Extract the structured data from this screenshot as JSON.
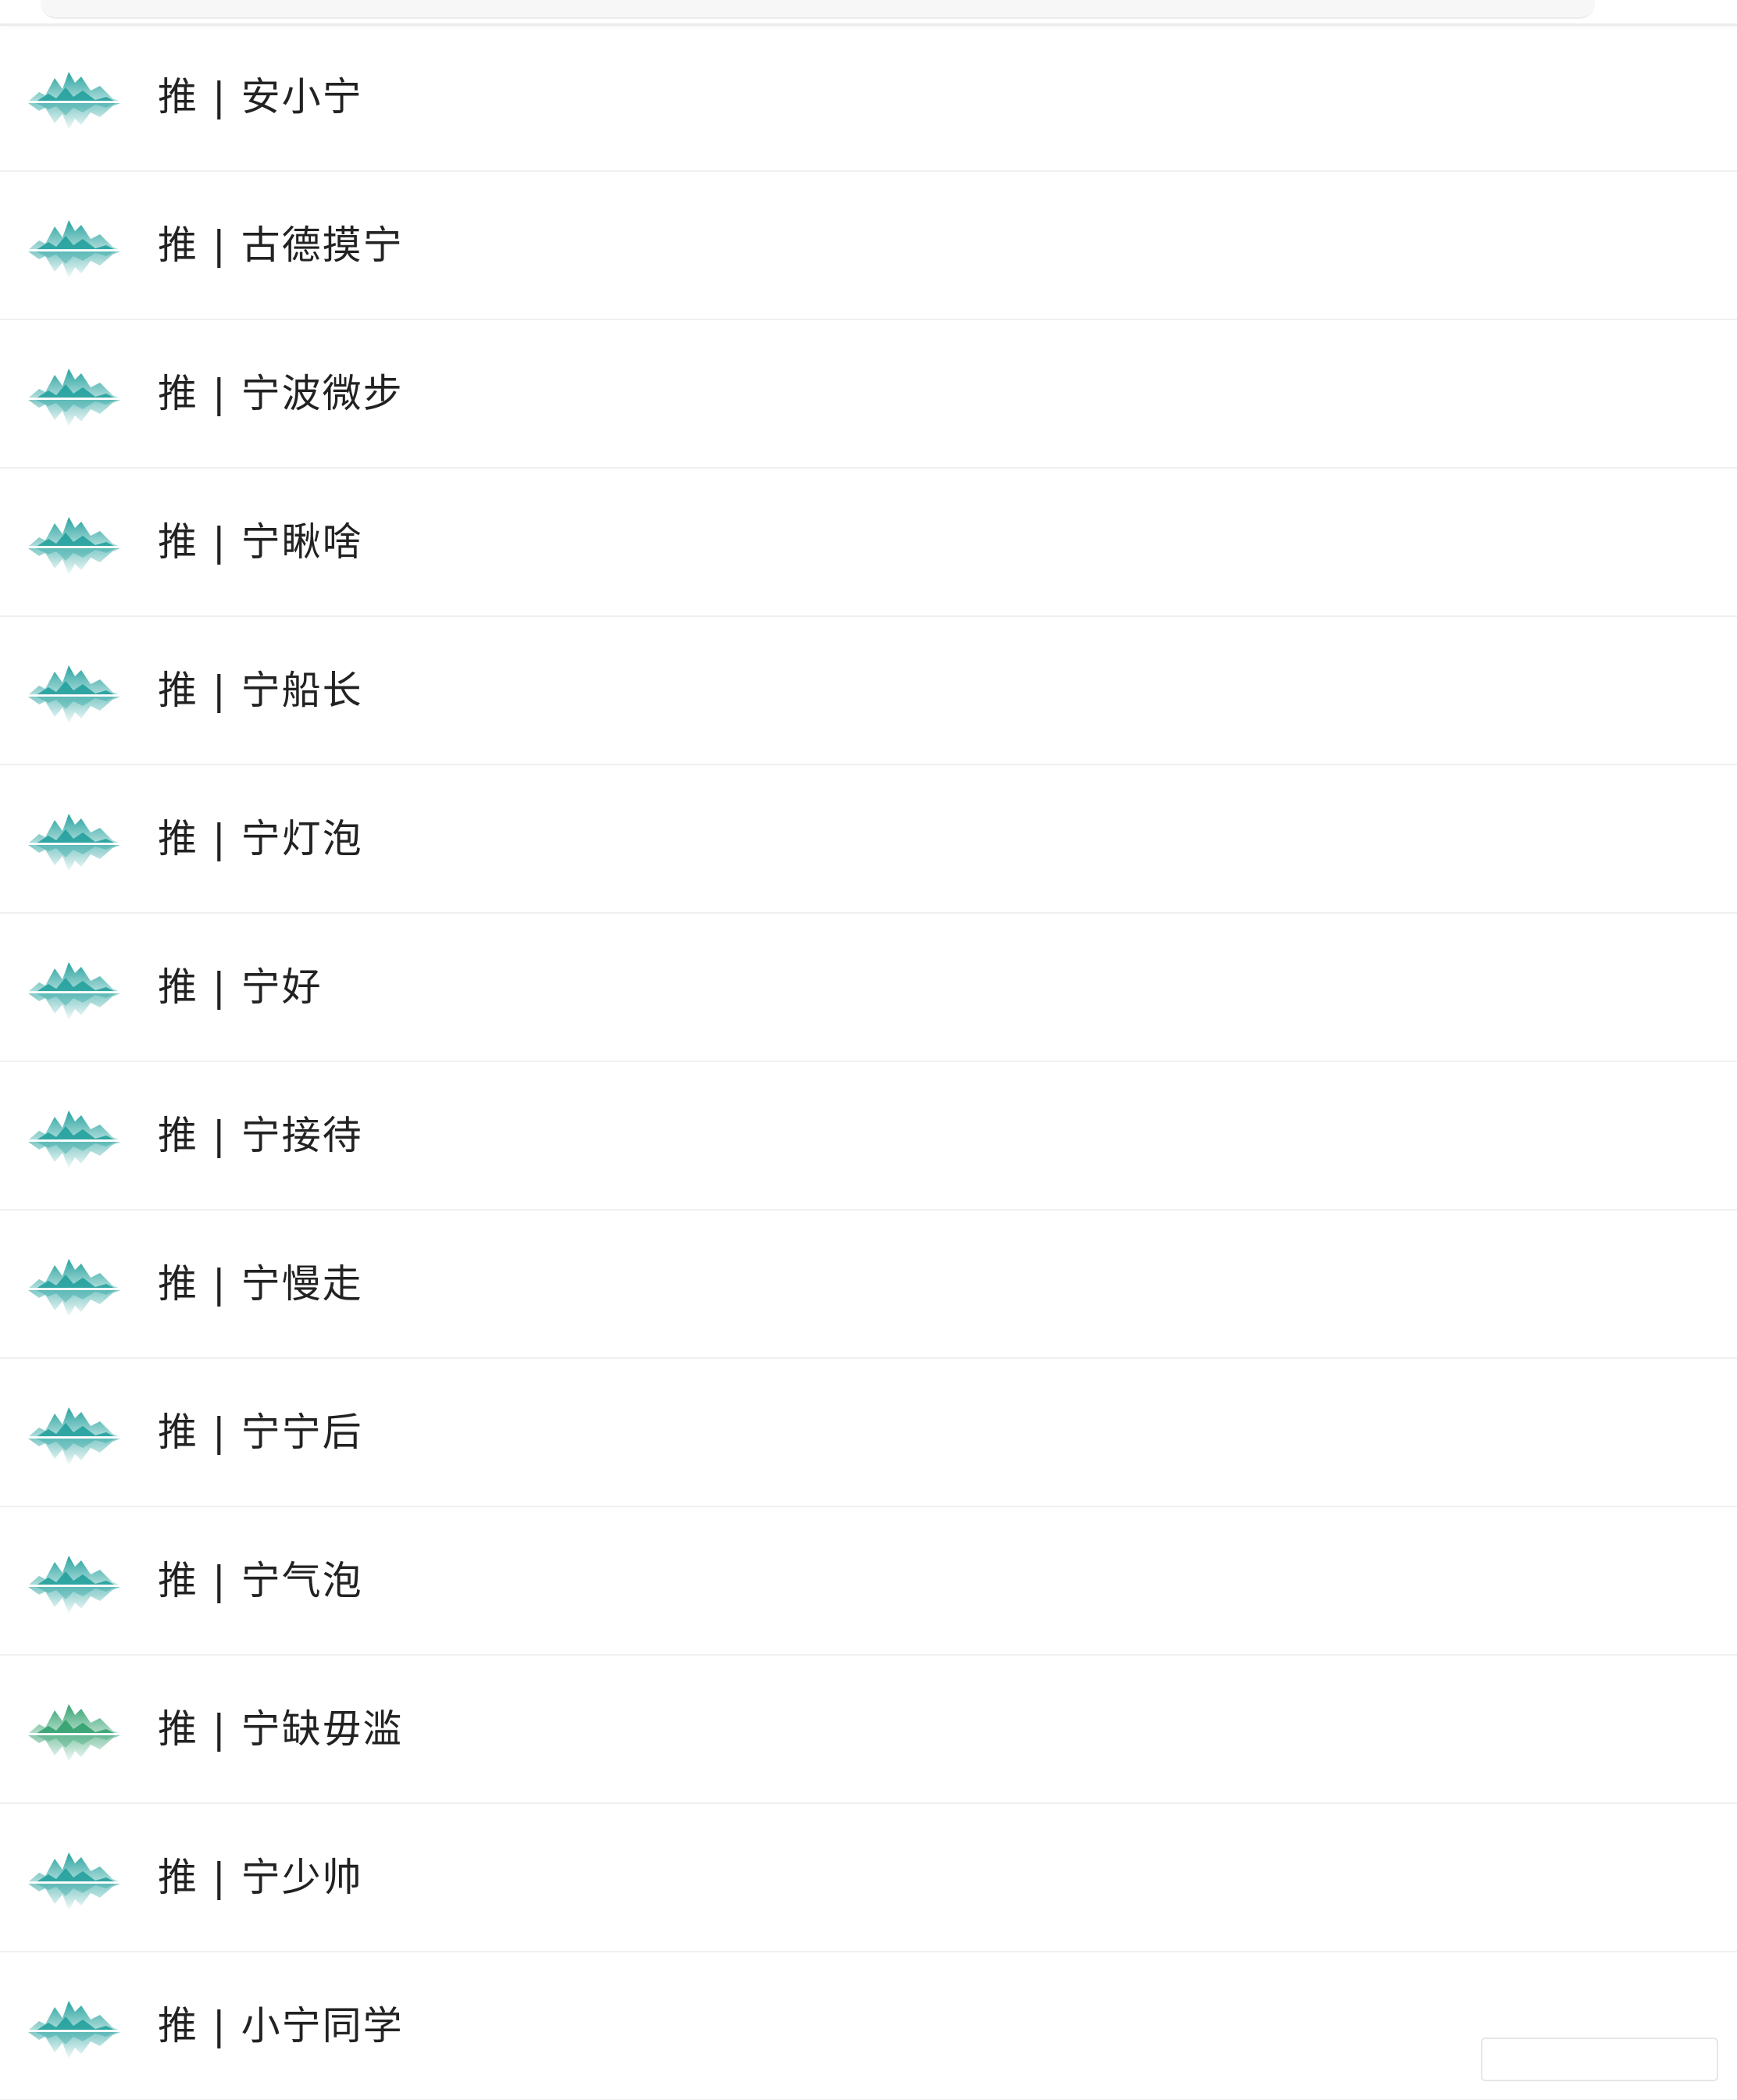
{
  "list": {
    "items": [
      {
        "label": "推 | 安小宁",
        "avatar_icon": "mountain-reflection-icon",
        "tint": "#1c9e9a"
      },
      {
        "label": "推 | 古德摸宁",
        "avatar_icon": "mountain-reflection-icon",
        "tint": "#1c9e9a"
      },
      {
        "label": "推 | 宁波微步",
        "avatar_icon": "mountain-reflection-icon",
        "tint": "#1c9e9a"
      },
      {
        "label": "推 | 宁瞅啥",
        "avatar_icon": "mountain-reflection-icon",
        "tint": "#1c9e9a"
      },
      {
        "label": "推 | 宁船长",
        "avatar_icon": "mountain-reflection-icon",
        "tint": "#1c9e9a"
      },
      {
        "label": "推 | 宁灯泡",
        "avatar_icon": "mountain-reflection-icon",
        "tint": "#1c9e9a"
      },
      {
        "label": "推 | 宁好",
        "avatar_icon": "mountain-reflection-icon",
        "tint": "#1c9e9a"
      },
      {
        "label": "推 | 宁接待",
        "avatar_icon": "mountain-reflection-icon",
        "tint": "#1c9e9a"
      },
      {
        "label": "推 | 宁慢走",
        "avatar_icon": "mountain-reflection-icon",
        "tint": "#1c9e9a"
      },
      {
        "label": "推 | 宁宁后",
        "avatar_icon": "mountain-reflection-icon",
        "tint": "#1c9e9a"
      },
      {
        "label": "推 | 宁气泡",
        "avatar_icon": "mountain-reflection-icon",
        "tint": "#1c9e9a"
      },
      {
        "label": "推 | 宁缺毋滥",
        "avatar_icon": "mountain-reflection-icon",
        "tint": "#2a9d6a"
      },
      {
        "label": "推 | 宁少帅",
        "avatar_icon": "mountain-reflection-icon",
        "tint": "#1c9e9a"
      },
      {
        "label": "推 | 小宁同学",
        "avatar_icon": "mountain-reflection-icon",
        "tint": "#1c9e9a"
      }
    ]
  },
  "colors": {
    "text": "#222222",
    "divider": "#f0f0f0",
    "background": "#ffffff"
  }
}
